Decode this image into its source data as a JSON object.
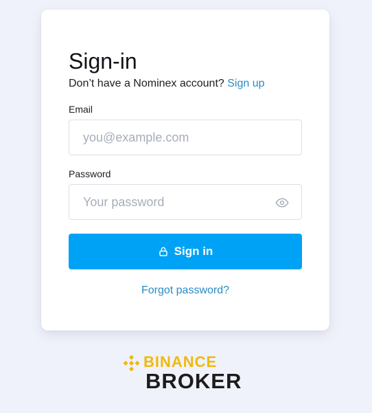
{
  "signin": {
    "title": "Sign-in",
    "no_account_text": "Don’t have a Nominex account?",
    "signup_link": "Sign up",
    "email_label": "Email",
    "email_placeholder": "you@example.com",
    "password_label": "Password",
    "password_placeholder": "Your password",
    "submit_label": "Sign in",
    "forgot_link": "Forgot password?"
  },
  "footer_logo": {
    "brand": "BINANCE",
    "product": "BROKER",
    "brand_color": "#F0B90B",
    "product_color": "#1C1C1C"
  },
  "colors": {
    "page_bg": "#F0F2FB",
    "primary_button": "#00A2F5",
    "link": "#2A8BC4"
  },
  "icons": {
    "password_toggle": "eye-icon",
    "submit": "lock-icon",
    "logo_mark": "binance-diamond-icon"
  }
}
